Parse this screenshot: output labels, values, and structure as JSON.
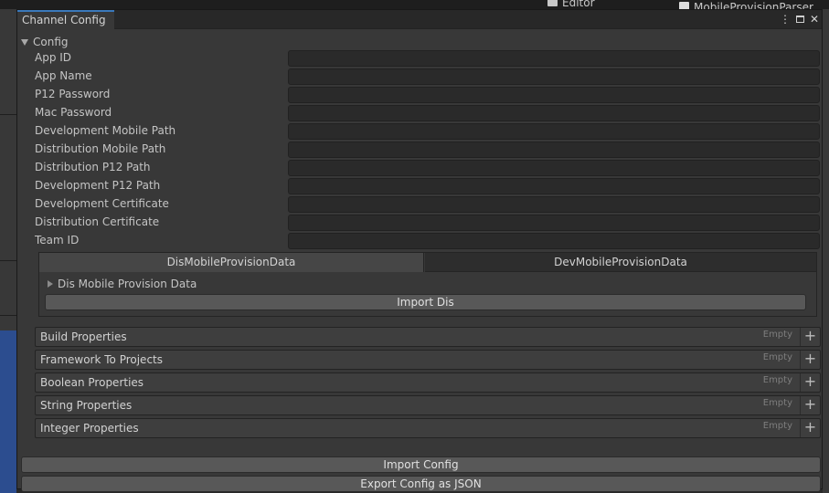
{
  "background": {
    "editor_label": "Editor",
    "asset_label": "MobileProvisionParser"
  },
  "window": {
    "title": "Channel Config",
    "menu_icon": "kebab-menu-icon",
    "maximize_icon": "maximize-icon",
    "close_icon": "close-icon"
  },
  "config": {
    "foldout_label": "Config",
    "fields": [
      {
        "label": "App ID",
        "value": ""
      },
      {
        "label": "App Name",
        "value": ""
      },
      {
        "label": "P12 Password",
        "value": ""
      },
      {
        "label": "Mac Password",
        "value": ""
      },
      {
        "label": "Development Mobile Path",
        "value": ""
      },
      {
        "label": "Distribution Mobile Path",
        "value": ""
      },
      {
        "label": "Distribution P12 Path",
        "value": ""
      },
      {
        "label": "Development P12 Path",
        "value": ""
      },
      {
        "label": "Development Certificate",
        "value": ""
      },
      {
        "label": "Distribution Certificate",
        "value": ""
      },
      {
        "label": "Team ID",
        "value": ""
      }
    ]
  },
  "provision_tabs": {
    "tabs": [
      "DisMobileProvisionData",
      "DevMobileProvisionData"
    ],
    "active_tab": "DisMobileProvisionData",
    "sub_foldout_label": "Dis Mobile Provision Data",
    "import_button": "Import Dis"
  },
  "lists": [
    {
      "label": "Build Properties",
      "empty": "Empty",
      "add": "+"
    },
    {
      "label": "Framework To Projects",
      "empty": "Empty",
      "add": "+"
    },
    {
      "label": "Boolean Properties",
      "empty": "Empty",
      "add": "+"
    },
    {
      "label": "String Properties",
      "empty": "Empty",
      "add": "+"
    },
    {
      "label": "Integer Properties",
      "empty": "Empty",
      "add": "+"
    }
  ],
  "actions": {
    "import_config": "Import Config",
    "export_json": "Export Config as JSON"
  },
  "colors": {
    "window_bg": "#383838",
    "field_bg": "#2a2a2a",
    "button_bg": "#585858",
    "accent_tab": "#3a79bb"
  }
}
